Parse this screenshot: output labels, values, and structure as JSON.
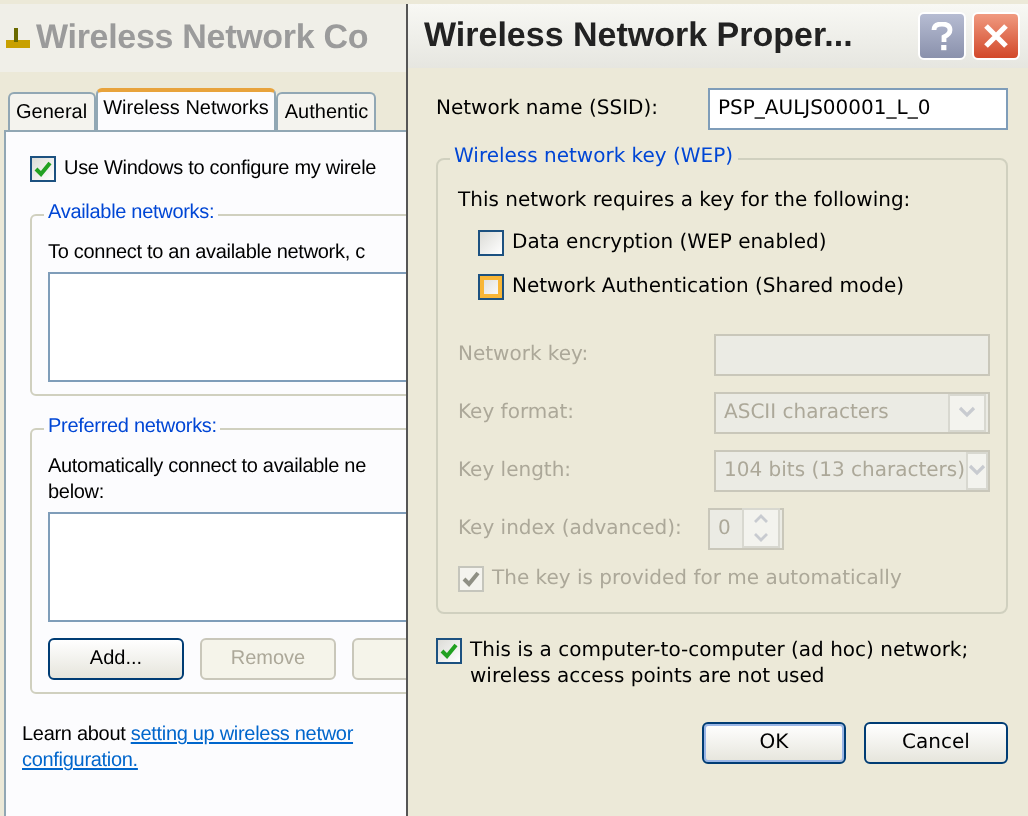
{
  "back_window": {
    "title": "Wireless Network Co",
    "tabs": [
      {
        "label": "General",
        "selected": false
      },
      {
        "label": "Wireless Networks",
        "selected": true
      },
      {
        "label": "Authentic",
        "selected": false
      }
    ],
    "use_windows": {
      "label": "Use Windows to configure my wirele",
      "checked": true
    },
    "available": {
      "title": "Available networks:",
      "text": "To connect to an available network, c"
    },
    "preferred": {
      "title": "Preferred networks:",
      "text": "Automatically connect to available ne\nbelow:"
    },
    "buttons": [
      {
        "label": "Add...",
        "disabled": false
      },
      {
        "label": "Remove",
        "disabled": true
      },
      {
        "disabled": true
      }
    ],
    "learn": {
      "text": "Learn about",
      "link": "setting up wireless networ",
      "link2": "configuration."
    }
  },
  "dialog": {
    "title": "Wireless Network Proper...",
    "ssid": {
      "label": "Network name (SSID):",
      "value": "PSP_AULJS00001_L_0"
    },
    "wep": {
      "title": "Wireless network key (WEP)",
      "intro": "This network requires a key for the following:",
      "options": [
        {
          "label": "Data encryption (WEP enabled)",
          "checked": false,
          "highlighted": false
        },
        {
          "label": "Network Authentication (Shared mode)",
          "checked": false,
          "highlighted": true
        }
      ],
      "fields": [
        {
          "kind": "text",
          "label": "Network key:",
          "disabled": true
        },
        {
          "kind": "dropdown",
          "label": "Key format:",
          "value": "ASCII characters",
          "disabled": true
        },
        {
          "kind": "dropdown",
          "label": "Key length:",
          "value": "104 bits (13 characters)",
          "disabled": true
        },
        {
          "kind": "spinner",
          "label": "Key index (advanced):",
          "value": "0",
          "disabled": true
        }
      ],
      "auto": {
        "label": "The key is provided for me automatically",
        "checked": true,
        "disabled": true
      }
    },
    "adhoc": {
      "label": "This is a computer-to-computer (ad hoc) network; wireless access points are not used",
      "checked": true
    },
    "buttons": [
      {
        "label": "OK",
        "kind": "default"
      },
      {
        "label": "Cancel",
        "kind": "normal"
      }
    ]
  }
}
